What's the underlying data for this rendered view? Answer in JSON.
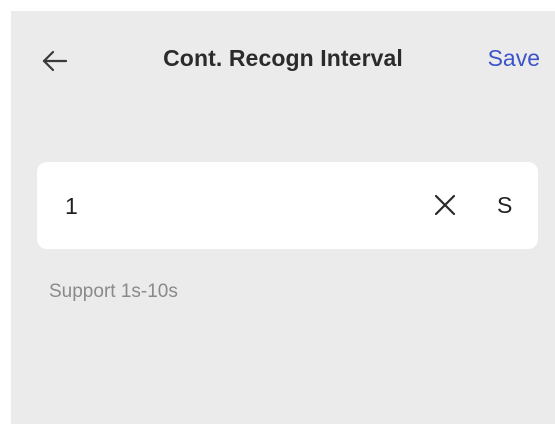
{
  "header": {
    "back_icon": "arrow-left-icon",
    "title": "Cont. Recogn Interval",
    "save_label": "Save"
  },
  "interval_input": {
    "value": "1",
    "clear_icon": "close-x-icon",
    "unit": "S"
  },
  "hint": "Support 1s-10s",
  "colors": {
    "background": "#ebebeb",
    "card": "#ffffff",
    "accent": "#3d54c9",
    "title_text": "#2b2b2b",
    "hint_text": "#8a8a8a"
  }
}
